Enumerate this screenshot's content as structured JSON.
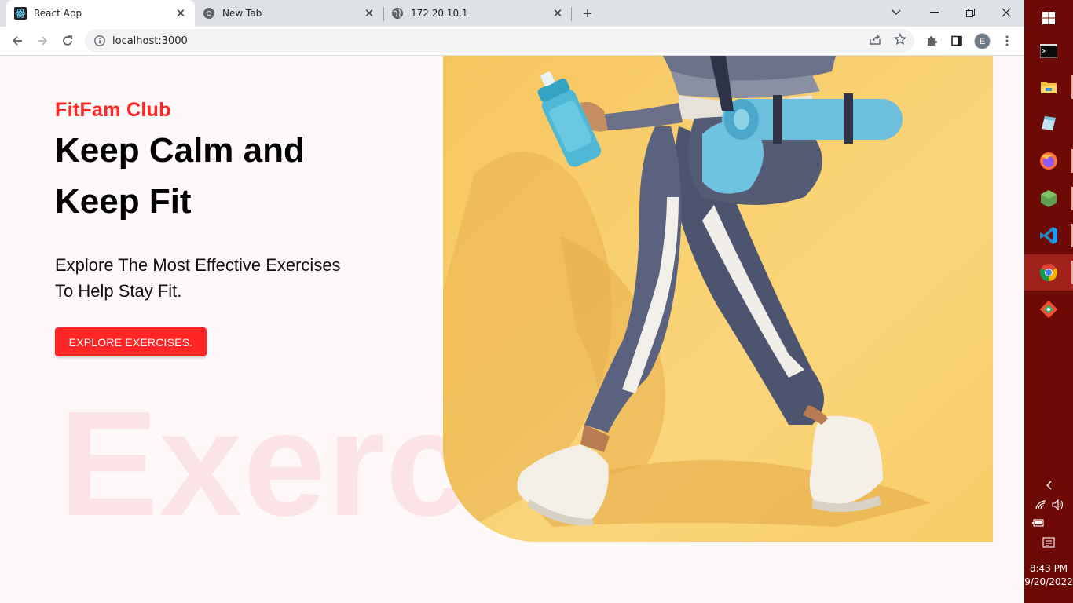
{
  "browser": {
    "tabs": [
      {
        "title": "React App",
        "icon": "react-icon",
        "active": true
      },
      {
        "title": "New Tab",
        "icon": "chrome-icon",
        "active": false
      },
      {
        "title": "172.20.10.1",
        "icon": "globe-icon",
        "active": false
      }
    ],
    "url": "localhost:3000",
    "profile_initial": "E"
  },
  "page": {
    "brand": "FitFam Club",
    "headline_line1": "Keep Calm and",
    "headline_line2": "Keep Fit",
    "subtitle_line1": "Explore The Most Effective Exercises",
    "subtitle_line2": "To Help Stay Fit.",
    "cta_label": "EXPLORE EXERCISES.",
    "background_word": "Exercise",
    "accent_color": "#ff2625",
    "hero_background": "#f9cf6b"
  },
  "taskbar": {
    "apps": [
      "windows-start-icon",
      "terminal-icon",
      "file-explorer-icon",
      "notes-icon",
      "firefox-icon",
      "nodejs-icon",
      "vscode-icon",
      "chrome-icon",
      "git-icon"
    ],
    "time": "8:43 PM",
    "date": "9/20/2022"
  }
}
